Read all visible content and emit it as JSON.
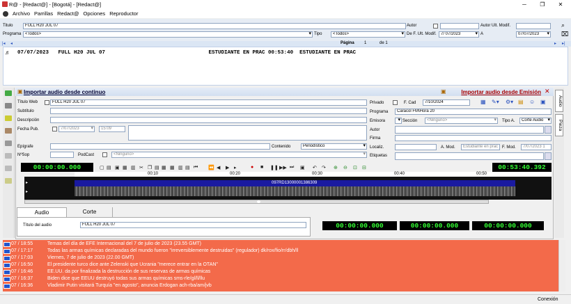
{
  "window": {
    "title": "R@ - [Redact@] - [Bogotá] - [Redact@]",
    "minimize": "─",
    "maximize": "❐",
    "close": "✕"
  },
  "menu": {
    "items": [
      "Archivo",
      "Parrillas",
      "Redact@",
      "Opciones",
      "Reproductor"
    ]
  },
  "filters": {
    "titulo_label": "Titulo",
    "titulo_value": "FULL H20 JUL 07",
    "autor_label": "Autor",
    "autor_ult_label": "Autor Ult. Modif.",
    "programa_label": "Programa",
    "programa_value": "<Todos>",
    "tipo_label": "Tipo",
    "tipo_value": "<Todos>",
    "de_fecha_label": "De F. Ult. Modif.",
    "de_fecha_value": "7/ 07/2023",
    "a_label": "A",
    "a_value": "07/07/2023"
  },
  "pager": {
    "pagina_label": "Página",
    "page": "1",
    "de_label": "de 1"
  },
  "list": {
    "row": "07/07/2023   FULL H20 JUL 07                                 ESTUDIANTE EN PRAC 00:53:40  ESTUDIANTE EN PRAC"
  },
  "panel": {
    "import_left": "Importar audio desde continuo",
    "import_right": "Importar audio desde Emisión"
  },
  "form": {
    "titulo_web_label": "Título Web",
    "titulo_web_value": "FULL H20 JUL 07",
    "subtitulo_label": "Subtítulo",
    "descripcion_label": "Descripción",
    "fecha_pub_label": "Fecha Pub.",
    "fecha_pub_value": "7/07/2023",
    "hora_pub_value": "15:09",
    "epigrafe_label": "Epígrafe",
    "nsop_label": "NºSop",
    "podcast_label": "PodCast",
    "podcast_value": "<Ninguno>",
    "contenido_label": "Contenido",
    "contenido_value": "Periodístico",
    "privado_label": "Privado",
    "fcad_label": "F. Cad",
    "fcad_value": "7/10/2024",
    "programa_label": "Programa",
    "programa_value": "Caracol FM\\Hora 20",
    "emisora_label": "Emisora",
    "seccion_label": "Sección",
    "seccion_value": "<Ninguno>",
    "tipo_a_label": "Tipo A.",
    "tipo_a_value": "Corte Audio",
    "autor_label": "Autor",
    "firma_label": "Firma",
    "localiz_label": "Localiz.",
    "a_mod_label": "A. Mod.",
    "a_mod_value": "Estudiante en prac",
    "f_mod_label": "F. Mod.",
    "f_mod_value": "7/07/2023 1",
    "etiquetas_label": "Etiquetas"
  },
  "player": {
    "time_left": "00:00:00.000",
    "time_right": "00:53:40.392",
    "ruler": [
      "00:10",
      "00:20",
      "00:30",
      "00:40",
      "00:50"
    ],
    "clip_id": "097RD13000001386309"
  },
  "tabs": {
    "audio": "Audio",
    "corte": "Corte",
    "titulo_audio_label": "Título del audio",
    "titulo_audio_value": "FULL H20 JUL 07",
    "t1": "00:00:00.000",
    "t2": "00:00:00.000",
    "t3": "00:00:00.000"
  },
  "side": {
    "audio": "Audio",
    "pieza": "Pieza"
  },
  "news": [
    {
      "time": "07 / 18:55",
      "text": "Temas del día de EFE Internacional del 7 de julio de 2023 (23.55 GMT)"
    },
    {
      "time": "07 / 17:17",
      "text": "Todas las armas químicas declaradas del mundo fueron \"irreversiblemente destruidas\" (regulador) dk/rox/fio/rr/dbh/ll"
    },
    {
      "time": "07 / 17:03",
      "text": "Viernes, 7 de julio de 2023 (22.00 GMT)"
    },
    {
      "time": "07 / 16:50",
      "text": "El presidente turco dice ante Zelenski que Ucrania \"merece entrar en la OTAN\""
    },
    {
      "time": "07 / 16:46",
      "text": "EE.UU. da por finalizada la destrucción de sus reservas de armas químicas"
    },
    {
      "time": "07 / 16:37",
      "text": "Biden dice que EEUU destruyó todas sus armas químicas sms-rle/gl/ll/llu"
    },
    {
      "time": "07 / 16:36",
      "text": "Vladimir Putin visitará Turquía \"en agosto\", anuncia Erdogan ach-rba/am/jvb"
    }
  ],
  "status": {
    "conexion": "Conexión"
  }
}
